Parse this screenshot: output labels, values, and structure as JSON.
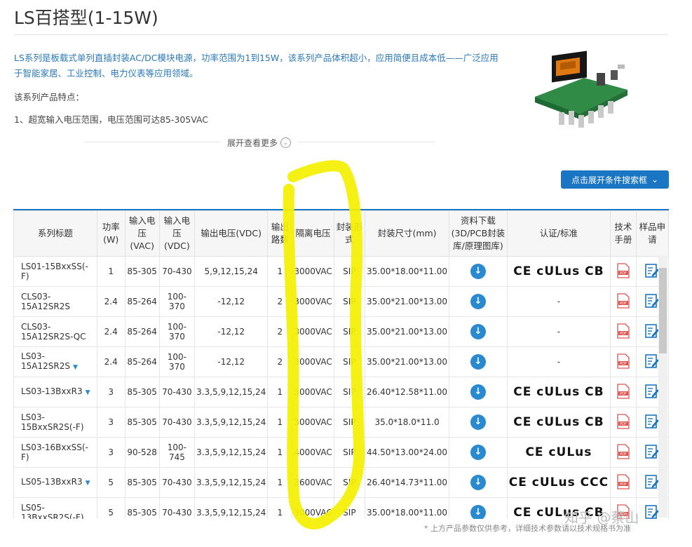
{
  "title": "LS百搭型(1-15W)",
  "description": "LS系列是板载式单列直插封装AC/DC模块电源，功率范围为1到15W，该系列产品体积超小，应用简便且成本低——广泛应用于智能家居、工业控制、电力仪表等应用领域。",
  "features_heading": "该系列产品特点：",
  "feature_1": "1、超宽输入电压范围，电压范围可达85-305VAC",
  "expand_more": "展开查看更多",
  "search_button": "点击展开条件搜索框",
  "table": {
    "headers": [
      "系列标题",
      "功率(W)",
      "输入电压(VAC)",
      "输入电压(VDC)",
      "输出电压(VDC)",
      "输出路数",
      "隔离电压",
      "封装形式",
      "封装尺寸(mm)",
      "资料下载(3D/PCB封装库/原理图库)",
      "认证/标准",
      "技术手册",
      "样品申请"
    ],
    "rows": [
      {
        "name": "LS01-15BxxSS(-F)",
        "tri": false,
        "power": "1",
        "vac": "85-305",
        "vdc": "70-430",
        "vout": "5,9,12,15,24",
        "paths": "1",
        "iso": "3000VAC",
        "pkg": "SIP",
        "size": "35.00*18.00*11.00",
        "cert": "CE cULus CB"
      },
      {
        "name": "CLS03-15A12SR2S",
        "tri": false,
        "power": "2.4",
        "vac": "85-264",
        "vdc": "100-370",
        "vout": "-12,12",
        "paths": "2",
        "iso": "3000VAC",
        "pkg": "SIP",
        "size": "35.00*21.00*13.00",
        "cert": "-"
      },
      {
        "name": "CLS03-15A12SR2S-QC",
        "tri": false,
        "power": "2.4",
        "vac": "85-264",
        "vdc": "100-370",
        "vout": "-12,12",
        "paths": "2",
        "iso": "3000VAC",
        "pkg": "SIP",
        "size": "35.00*21.00*13.00",
        "cert": "-"
      },
      {
        "name": "LS03-15A12SR2S",
        "tri": true,
        "power": "2.4",
        "vac": "85-264",
        "vdc": "100-370",
        "vout": "-12,12",
        "paths": "2",
        "iso": "3000VAC",
        "pkg": "SIP",
        "size": "35.00*21.00*13.00",
        "cert": "-"
      },
      {
        "name": "LS03-13BxxR3",
        "tri": true,
        "power": "3",
        "vac": "85-305",
        "vdc": "70-430",
        "vout": "3.3,5,9,12,15,24",
        "paths": "1",
        "iso": "3000VAC",
        "pkg": "SIP",
        "size": "26.40*12.58*11.00",
        "cert": "CE cULus CB"
      },
      {
        "name": "LS03-15BxxSR2S(-F)",
        "tri": false,
        "power": "3",
        "vac": "85-305",
        "vdc": "70-430",
        "vout": "3.3,5,9,12,15,24",
        "paths": "1",
        "iso": "3000VAC",
        "pkg": "SIP",
        "size": "35.0*18.0*11.0",
        "cert": "CE cULus CB"
      },
      {
        "name": "LS03-16BxxSS(-F)",
        "tri": false,
        "power": "3",
        "vac": "90-528",
        "vdc": "100-745",
        "vout": "3.3,5,9,12,15,24",
        "paths": "1",
        "iso": "4000VAC",
        "pkg": "SIP",
        "size": "44.50*13.00*24.00",
        "cert": "CE cULus"
      },
      {
        "name": "LS05-13BxxR3",
        "tri": true,
        "power": "5",
        "vac": "85-305",
        "vdc": "70-430",
        "vout": "3.3,5,9,12,15,24",
        "paths": "1",
        "iso": "3600VAC",
        "pkg": "SIP",
        "size": "26.40*14.73*11.00",
        "cert": "CE cULus CCC"
      },
      {
        "name": "LS05-13BxxSR2S(-F)",
        "tri": false,
        "power": "5",
        "vac": "85-305",
        "vdc": "70-430",
        "vout": "3.3,5,9,12,15,24",
        "paths": "1",
        "iso": "3000VAC",
        "pkg": "SIP",
        "size": "35.00*18.00*11.00",
        "cert": "CE cULus CB"
      }
    ]
  },
  "footnote": "* 上方产品参数仅供参考，详细技术参数请以技术规格书为准",
  "watermark": "知乎 @蔡山",
  "colors": {
    "accent": "#1a76c2",
    "link": "#2a78b8",
    "highlight": "#f5f000"
  }
}
